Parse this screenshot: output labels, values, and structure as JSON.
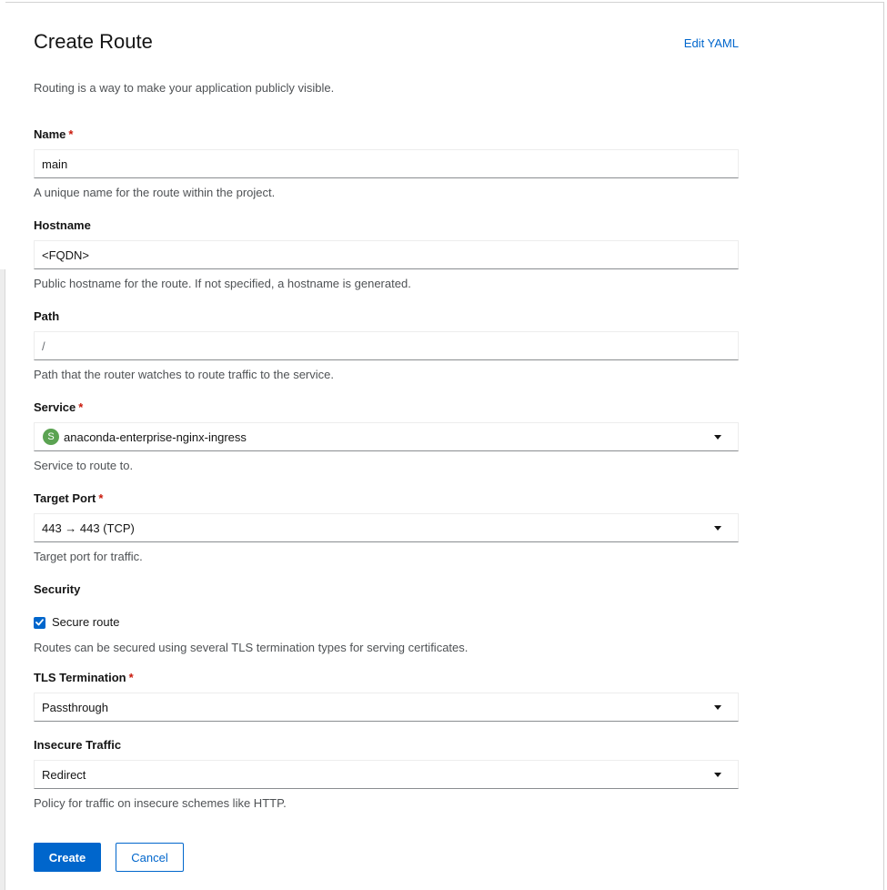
{
  "page": {
    "title": "Create Route",
    "edit_yaml_label": "Edit YAML",
    "intro": "Routing is a way to make your application publicly visible."
  },
  "form": {
    "name": {
      "label": "Name",
      "required": "*",
      "value": "main",
      "help": "A unique name for the route within the project."
    },
    "hostname": {
      "label": "Hostname",
      "value": "<FQDN>",
      "help": "Public hostname for the route. If not specified, a hostname is generated."
    },
    "path": {
      "label": "Path",
      "placeholder": "/",
      "help": "Path that the router watches to route traffic to the service."
    },
    "service": {
      "label": "Service",
      "required": "*",
      "badge": "S",
      "value": "anaconda-enterprise-nginx-ingress",
      "help": "Service to route to."
    },
    "target_port": {
      "label": "Target Port",
      "required": "*",
      "value": "443 → 443 (TCP)",
      "help": "Target port for traffic."
    },
    "security": {
      "label": "Security",
      "secure_route_label": "Secure route",
      "secure_route_checked": true,
      "help": "Routes can be secured using several TLS termination types for serving certificates."
    },
    "tls_termination": {
      "label": "TLS Termination",
      "required": "*",
      "value": "Passthrough"
    },
    "insecure_traffic": {
      "label": "Insecure Traffic",
      "value": "Redirect",
      "help": "Policy for traffic on insecure schemes like HTTP."
    }
  },
  "actions": {
    "create_label": "Create",
    "cancel_label": "Cancel"
  },
  "colors": {
    "primary": "#0066cc",
    "required": "#c9190b",
    "service_badge": "#5ba352"
  }
}
